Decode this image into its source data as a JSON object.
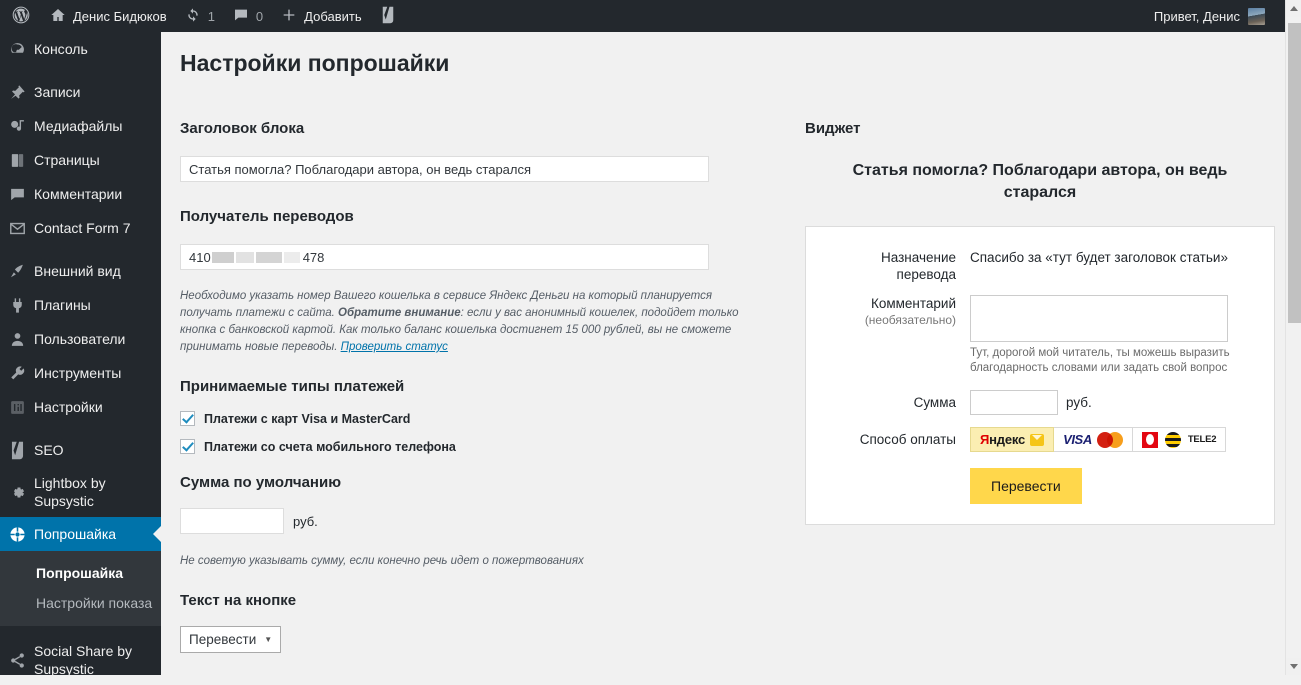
{
  "adminbar": {
    "site_name": "Денис Бидюков",
    "updates_count": "1",
    "comments_count": "0",
    "new_label": "Добавить",
    "greeting": "Привет, Денис",
    "icons": {
      "wordpress": "wordpress-logo-icon",
      "home": "home-icon",
      "updates": "updates-icon",
      "comments": "comment-bubble-icon",
      "new": "plus-icon",
      "seo": "yoast-seo-icon",
      "avatar": "user-avatar"
    }
  },
  "sidebar": {
    "items": [
      {
        "label": "Консоль",
        "icon": "dashboard-icon",
        "sep": false
      },
      {
        "label": "Записи",
        "icon": "pin-icon",
        "sep": true
      },
      {
        "label": "Медиафайлы",
        "icon": "media-icon",
        "sep": false
      },
      {
        "label": "Страницы",
        "icon": "pages-icon",
        "sep": false
      },
      {
        "label": "Комментарии",
        "icon": "comment-bubble-icon",
        "sep": false
      },
      {
        "label": "Contact Form 7",
        "icon": "envelope-icon",
        "sep": false
      },
      {
        "label": "Внешний вид",
        "icon": "appearance-brush-icon",
        "sep": true
      },
      {
        "label": "Плагины",
        "icon": "plugin-plug-icon",
        "sep": false
      },
      {
        "label": "Пользователи",
        "icon": "users-icon",
        "sep": false
      },
      {
        "label": "Инструменты",
        "icon": "tools-wrench-icon",
        "sep": false
      },
      {
        "label": "Настройки",
        "icon": "settings-sliders-icon",
        "sep": false
      },
      {
        "label": "SEO",
        "icon": "yoast-seo-icon",
        "sep": true
      },
      {
        "label": "Lightbox by Supsystic",
        "icon": "gear-icon",
        "sep": false
      },
      {
        "label": "Попрошайка",
        "icon": "donate-icon",
        "sep": false,
        "current": true
      },
      {
        "label": "Social Share by Supsystic",
        "icon": "share-icon",
        "sep": true
      }
    ],
    "submenu": [
      {
        "label": "Попрошайка",
        "current": true
      },
      {
        "label": "Настройки показа",
        "current": false
      }
    ]
  },
  "page": {
    "title": "Настройки попрошайки"
  },
  "settings": {
    "block_title_label": "Заголовок блока",
    "block_title_value": "Статья помогла? Поблагодари автора, он ведь старался",
    "receiver_label": "Получатель переводов",
    "receiver_prefix": "410",
    "receiver_suffix": "478",
    "receiver_note_1": "Необходимо указать номер Вашего кошелька в сервисе Яндекс Деньги на который планируется получать платежи с сайта. ",
    "receiver_note_bold": "Обратите внимание",
    "receiver_note_2": ": если у вас анонимный кошелек, подойдет только кнопка с банковской картой. Как только баланс кошелька достигнет 15 000 рублей, вы не сможете принимать новые переводы. ",
    "receiver_note_link": "Проверить статус",
    "payment_types_label": "Принимаемые типы платежей",
    "payment_types": [
      {
        "label": "Платежи с карт Visa и MasterCard",
        "checked": true
      },
      {
        "label": "Платежи со счета мобильного телефона",
        "checked": true
      }
    ],
    "default_amount_label": "Сумма по умолчанию",
    "default_amount_value": "",
    "default_amount_unit": "руб.",
    "default_amount_note": "Не советую указывать сумму, если конечно речь идет о пожертвованиях",
    "button_text_label": "Текст на кнопке",
    "button_text_value": "Перевести"
  },
  "widget": {
    "section_label": "Виджет",
    "title": "Статья помогла? Поблагодари автора, он ведь старался",
    "purpose_label": "Назначение перевода",
    "purpose_value": "Спасибо за «тут будет заголовок статьи»",
    "comment_label": "Комментарий",
    "comment_sub": "(необязательно)",
    "comment_value": "",
    "comment_note": "Тут, дорогой мой читатель, ты можешь выразить благодарность словами или задать свой вопрос",
    "amount_label": "Сумма",
    "amount_value": "",
    "amount_unit": "руб.",
    "pay_method_label": "Способ оплаты",
    "pay_tiles": [
      {
        "name": "yandex-money",
        "selected": true,
        "text_red": "Я",
        "text_black": "ндекс"
      },
      {
        "name": "visa-mastercard",
        "selected": false,
        "visa_text": "VISA"
      },
      {
        "name": "mobile-operators",
        "selected": false,
        "tele2_text": "TELE2"
      }
    ],
    "submit_label": "Перевести"
  },
  "colors": {
    "admin_dark": "#23282d",
    "submenu_dark": "#32373c",
    "accent_blue": "#0073aa",
    "content_bg": "#f1f1f1",
    "yandex_yellow": "#ffd74b",
    "tile_selected": "#fbeeb2"
  }
}
